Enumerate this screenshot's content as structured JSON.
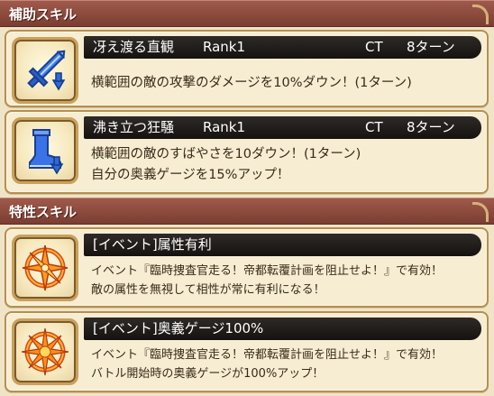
{
  "sections": {
    "support_title": "補助スキル",
    "trait_title": "特性スキル"
  },
  "support_skills": [
    {
      "name": "冴え渡る直観",
      "rank": "Rank1",
      "ct_label": "CT",
      "ct_value": "8ターン",
      "desc_lines": [
        "横範囲の敵の攻撃のダメージを10%ダウン！(1ターン)"
      ],
      "icon": "blue-sword-down-arrow-icon"
    },
    {
      "name": "沸き立つ狂騒",
      "rank": "Rank1",
      "ct_label": "CT",
      "ct_value": "8ターン",
      "desc_lines": [
        "横範囲の敵のすばやさを10ダウン！(1ターン)",
        "自分の奥義ゲージを15%アップ！"
      ],
      "icon": "blue-boot-down-arrow-icon"
    }
  ],
  "trait_skills": [
    {
      "name": "[イベント]属性有利",
      "desc_lines": [
        "イベント『臨時捜査官走る！帝都転覆計画を阻止せよ！』で有効！",
        "敵の属性を無視して相性が常に有利になる！"
      ],
      "icon": "orange-compass-star-icon"
    },
    {
      "name": "[イベント]奥義ゲージ100%",
      "desc_lines": [
        "イベント『臨時捜査官走る！帝都転覆計画を阻止せよ！』で有効！",
        "バトル開始時の奥義ゲージが100%アップ！"
      ],
      "icon": "orange-burst-star-icon"
    }
  ],
  "colors": {
    "header": "#8b4a3c",
    "card_bg": "#f6edd3",
    "name_bar": "#1e1a17",
    "icon_blue": "#2f68d8",
    "icon_orange": "#f08a1c"
  }
}
